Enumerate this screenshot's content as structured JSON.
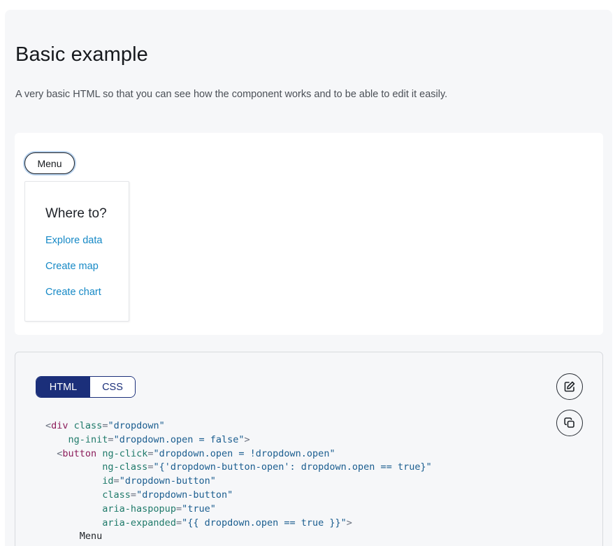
{
  "header": {
    "title": "Basic example",
    "description": "A very basic HTML so that you can see how the component works and to be able to edit it easily."
  },
  "demo": {
    "menu_button_label": "Menu",
    "dropdown": {
      "heading": "Where to?",
      "links": [
        "Explore data",
        "Create map",
        "Create chart"
      ]
    }
  },
  "code_panel": {
    "tabs": [
      {
        "label": "HTML",
        "active": true
      },
      {
        "label": "CSS",
        "active": false
      }
    ],
    "actions": {
      "edit_icon": "edit-icon",
      "copy_icon": "copy-icon"
    },
    "code_lines": [
      [
        [
          "punc",
          "<"
        ],
        [
          "tag",
          "div"
        ],
        [
          "punc",
          " "
        ],
        [
          "attr",
          "class"
        ],
        [
          "punc",
          "="
        ],
        [
          "str",
          "\"dropdown\""
        ]
      ],
      [
        [
          "punc",
          "    "
        ],
        [
          "attr",
          "ng-init"
        ],
        [
          "punc",
          "="
        ],
        [
          "str",
          "\"dropdown.open = false\""
        ],
        [
          "punc",
          ">"
        ]
      ],
      [
        [
          "punc",
          "  <"
        ],
        [
          "tag",
          "button"
        ],
        [
          "punc",
          " "
        ],
        [
          "attr",
          "ng-click"
        ],
        [
          "punc",
          "="
        ],
        [
          "str",
          "\"dropdown.open = !dropdown.open\""
        ]
      ],
      [
        [
          "punc",
          "          "
        ],
        [
          "attr",
          "ng-class"
        ],
        [
          "punc",
          "="
        ],
        [
          "str",
          "\"{'dropdown-button-open': dropdown.open == true}\""
        ]
      ],
      [
        [
          "punc",
          "          "
        ],
        [
          "attr",
          "id"
        ],
        [
          "punc",
          "="
        ],
        [
          "str",
          "\"dropdown-button\""
        ]
      ],
      [
        [
          "punc",
          "          "
        ],
        [
          "attr",
          "class"
        ],
        [
          "punc",
          "="
        ],
        [
          "str",
          "\"dropdown-button\""
        ]
      ],
      [
        [
          "punc",
          "          "
        ],
        [
          "attr",
          "aria-haspopup"
        ],
        [
          "punc",
          "="
        ],
        [
          "str",
          "\"true\""
        ]
      ],
      [
        [
          "punc",
          "          "
        ],
        [
          "attr",
          "aria-expanded"
        ],
        [
          "punc",
          "="
        ],
        [
          "str",
          "\"{{ dropdown.open == true }}\""
        ],
        [
          "punc",
          ">"
        ]
      ],
      [
        [
          "text",
          "      Menu"
        ]
      ]
    ]
  },
  "colors": {
    "accent": "#1b2f7a",
    "link": "#1689c6",
    "focus_ring": "#b9d3ee"
  }
}
